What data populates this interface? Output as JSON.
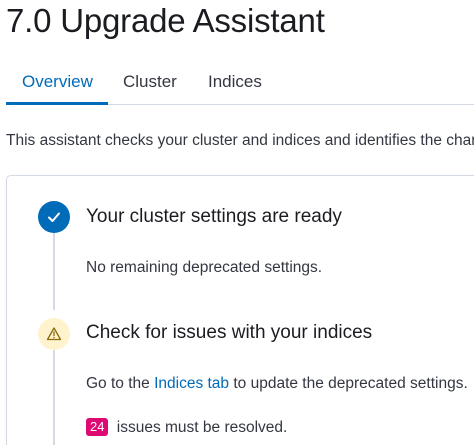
{
  "header": {
    "title": "7.0 Upgrade Assistant"
  },
  "tabs": [
    {
      "label": "Overview",
      "active": true
    },
    {
      "label": "Cluster",
      "active": false
    },
    {
      "label": "Indices",
      "active": false
    }
  ],
  "intro": "This assistant checks your cluster and indices and identifies the changes",
  "steps": [
    {
      "title": "Your cluster settings are ready",
      "status": "complete",
      "icon": "check-icon",
      "text": "No remaining deprecated settings."
    },
    {
      "title": "Check for issues with your indices",
      "status": "warning",
      "icon": "warning-icon",
      "text_before": "Go to the ",
      "link": "Indices tab",
      "text_after": " to update the deprecated settings.",
      "issue_count": "24",
      "issue_text": " issues must be resolved."
    }
  ],
  "colors": {
    "accent": "#006bb8",
    "badge": "#dd0a73",
    "warning_bg": "#fef3cd",
    "warning_stroke": "#8a6a0a"
  }
}
